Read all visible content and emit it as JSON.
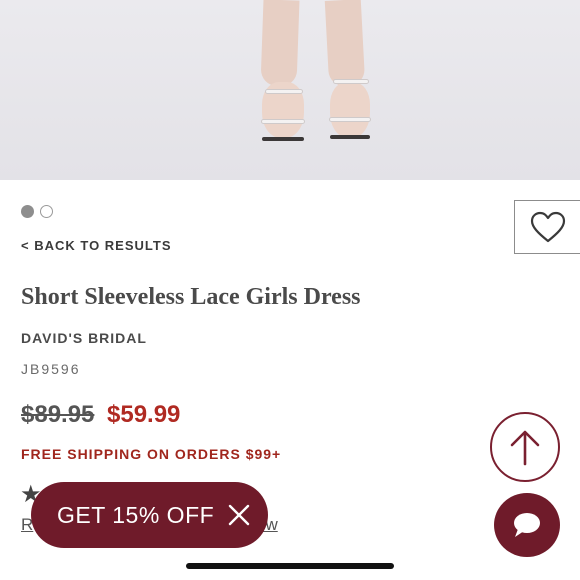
{
  "gallery": {
    "dots": [
      "active",
      "inactive"
    ]
  },
  "nav": {
    "back_label": "< BACK TO RESULTS"
  },
  "product": {
    "title": "Short Sleeveless Lace Girls Dress",
    "brand": "DAVID'S BRIDAL",
    "sku": "JB9596",
    "original_price": "$89.95",
    "sale_price": "$59.99",
    "shipping_note": "FREE SHIPPING ON ORDERS $99+"
  },
  "reviews": {
    "star_glyph": "★",
    "link_left": "R",
    "link_right": "ew"
  },
  "promo": {
    "label": "GET 15% OFF"
  },
  "icons": {
    "favorite": "heart-icon",
    "promo_close": "close-icon",
    "scroll_top": "arrow-up-icon",
    "chat": "chat-bubble-icon"
  },
  "colors": {
    "brand": "#6f1b2a",
    "sale": "#b02a22",
    "shipping": "#a0261d"
  }
}
